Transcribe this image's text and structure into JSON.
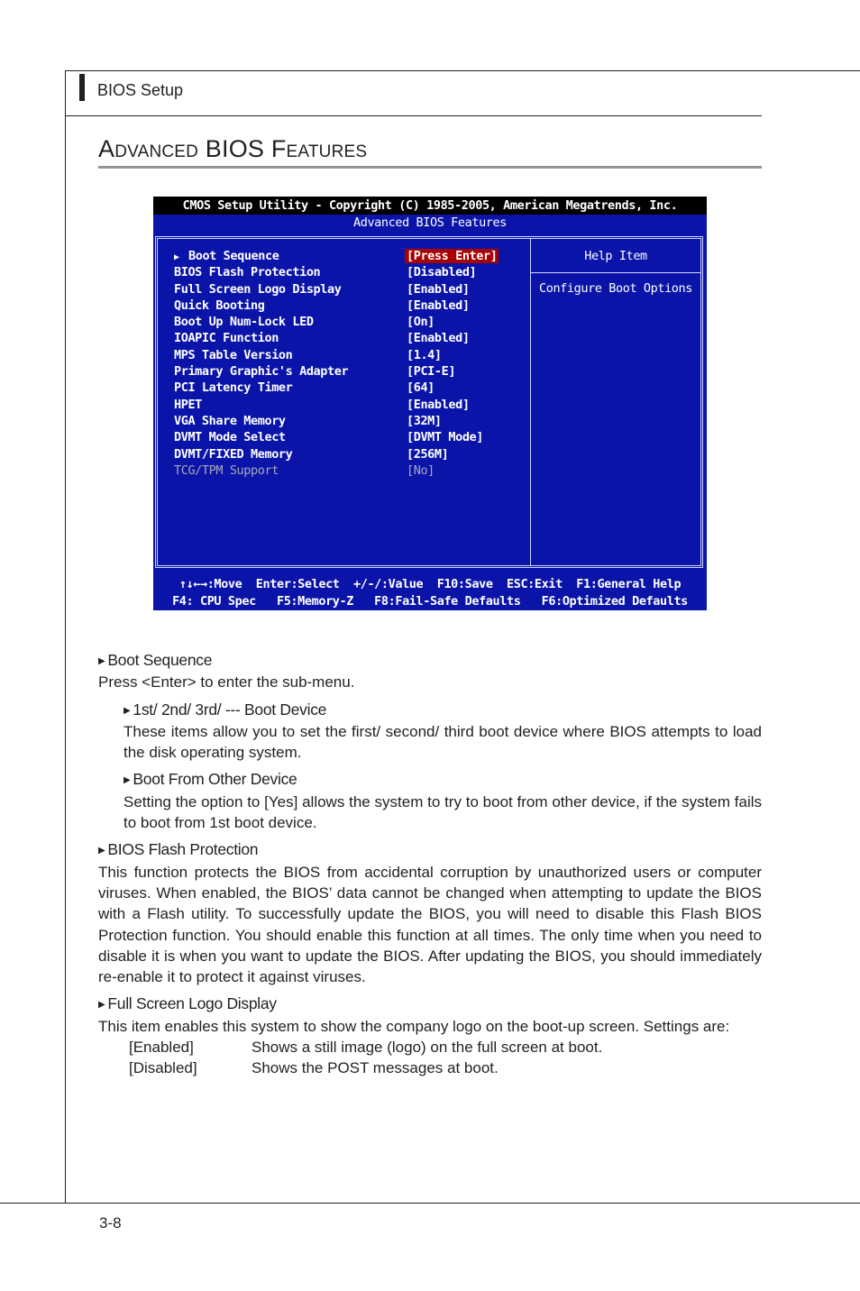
{
  "header": {
    "section": "BIOS Setup"
  },
  "title": "Advanced BIOS Features",
  "bios_screen": {
    "top_bar": "CMOS Setup Utility - Copyright (C) 1985-2005, American Megatrends, Inc.",
    "subtitle": "Advanced BIOS Features",
    "items": [
      {
        "label": "Boot Sequence",
        "value": "[Press Enter]",
        "submenu": true,
        "selected": true
      },
      {
        "label": "BIOS Flash Protection",
        "value": "[Disabled]"
      },
      {
        "label": "Full Screen Logo Display",
        "value": "[Enabled]"
      },
      {
        "label": "Quick Booting",
        "value": "[Enabled]"
      },
      {
        "label": "Boot Up Num-Lock LED",
        "value": "[On]"
      },
      {
        "label": "IOAPIC Function",
        "value": "[Enabled]"
      },
      {
        "label": "MPS Table Version",
        "value": "[1.4]"
      },
      {
        "label": "Primary Graphic's Adapter",
        "value": "[PCI-E]"
      },
      {
        "label": "PCI Latency Timer",
        "value": "[64]"
      },
      {
        "label": "HPET",
        "value": "[Enabled]"
      },
      {
        "label": "VGA Share Memory",
        "value": "[32M]"
      },
      {
        "label": "DVMT Mode Select",
        "value": "[DVMT Mode]"
      },
      {
        "label": "DVMT/FIXED Memory",
        "value": "[256M]"
      },
      {
        "label": "TCG/TPM Support",
        "value": "[No]",
        "disabled": true
      }
    ],
    "help_title": "Help Item",
    "help_text": "Configure Boot Options",
    "footer_line1": "↑↓←→:Move  Enter:Select  +/-/:Value  F10:Save  ESC:Exit  F1:General Help",
    "footer_line2": "F4: CPU Spec   F5:Memory-Z   F8:Fail-Safe Defaults   F6:Optimized Defaults",
    "colors": {
      "background": "#0a14a8",
      "top_bar": "#000000",
      "selected": "#a80000",
      "disabled_text": "#a8a8b8"
    }
  },
  "sections": {
    "boot_sequence": {
      "heading": "Boot Sequence",
      "text": "Press <Enter> to enter the sub-menu.",
      "boot_device": {
        "heading": "1st/ 2nd/ 3rd/ --- Boot Device",
        "text": "These items allow you to set the first/ second/ third boot device where BIOS attempts to load the disk operating system."
      },
      "boot_other": {
        "heading": "Boot From Other Device",
        "text": "Setting the option to [Yes] allows the system to try to boot from other device, if the system fails to boot from 1st boot device."
      }
    },
    "flash_protection": {
      "heading": "BIOS Flash Protection",
      "text": "This function protects the BIOS from accidental corruption by unauthorized users or computer viruses. When enabled, the BIOS’ data cannot be changed when attempting to update the BIOS with a Flash utility. To successfully update the BIOS, you will need to disable this Flash BIOS Protection function. You should enable this function at all times. The only time when you need to disable it is when you want to update the BIOS. After updating the BIOS, you should immediately re-enable it to protect it against viruses."
    },
    "logo_display": {
      "heading": "Full Screen Logo Display",
      "text": "This item enables this system to show the company logo on the boot-up screen. Settings are:",
      "options": [
        {
          "key": "[Enabled]",
          "desc": "Shows a still image (logo) on the full screen at boot."
        },
        {
          "key": "[Disabled]",
          "desc": "Shows the POST messages at boot."
        }
      ]
    }
  },
  "page_number": "3-8"
}
